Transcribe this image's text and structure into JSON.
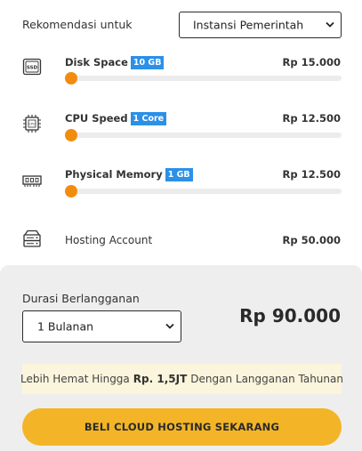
{
  "recommendation": {
    "label": "Rekomendasi untuk",
    "selected": "Instansi Pemerintah"
  },
  "resources": [
    {
      "name": "Disk Space",
      "badge": "10 GB",
      "price": "Rp 15.000",
      "icon": "ssd-icon",
      "slider_fraction": 0
    },
    {
      "name": "CPU Speed",
      "badge": "1 Core",
      "price": "Rp 12.500",
      "icon": "cpu-icon",
      "slider_fraction": 0
    },
    {
      "name": "Physical Memory",
      "badge": "1 GB",
      "price": "Rp 12.500",
      "icon": "memory-icon",
      "slider_fraction": 0
    }
  ],
  "hosting": {
    "label": "Hosting Account",
    "price": "Rp 50.000",
    "icon": "server-icon"
  },
  "subscription": {
    "label": "Durasi Berlangganan",
    "selected": "1 Bulanan",
    "total": "Rp 90.000"
  },
  "promo": {
    "prefix": "Lebih Hemat Hingga",
    "amount": "Rp. 1,5JT",
    "suffix": "Dengan Langganan Tahunan"
  },
  "cta": {
    "label": "BELI CLOUD HOSTING SEKARANG"
  },
  "colors": {
    "slider_thumb": "#f28c0f",
    "badge": "#2a90e8",
    "cta": "#f3b527",
    "promo_bg": "#fbf5dd",
    "panel_bg": "#eeeeee"
  }
}
